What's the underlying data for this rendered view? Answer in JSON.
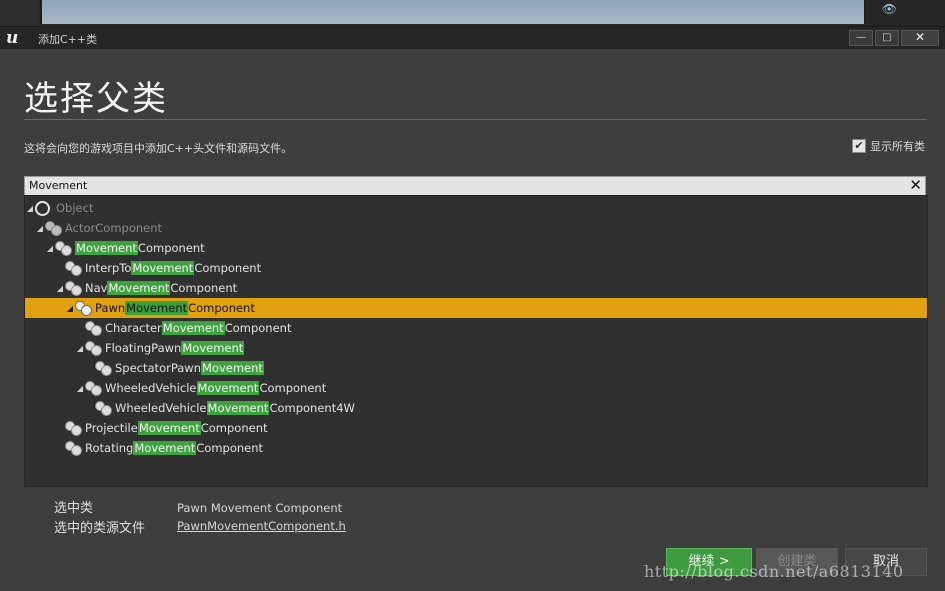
{
  "dialog": {
    "title": "添加C++类",
    "heading": "选择父类",
    "description": "这将会向您的游戏项目中添加C++头文件和源码文件。",
    "show_all_label": "显示所有类",
    "show_all_checked": true
  },
  "window_buttons": {
    "minimize": "—",
    "maximize": "□",
    "close": "✕"
  },
  "search": {
    "value": "Movement",
    "clear": "✕"
  },
  "tree": [
    {
      "pre": "Object",
      "hl": "",
      "post": "",
      "depth": 0,
      "expanded": true,
      "icon": "ring-icon",
      "dim": true,
      "selected": false
    },
    {
      "pre": "ActorComponent",
      "hl": "",
      "post": "",
      "depth": 1,
      "expanded": true,
      "icon": "gears-icon",
      "dim": true,
      "selected": false
    },
    {
      "pre": "",
      "hl": "Movement",
      "post": "Component",
      "depth": 2,
      "expanded": true,
      "icon": "gears-icon",
      "dim": false,
      "selected": false
    },
    {
      "pre": "InterpTo",
      "hl": "Movement",
      "post": "Component",
      "depth": 3,
      "expanded": false,
      "icon": "gears-icon",
      "dim": false,
      "selected": false
    },
    {
      "pre": "Nav",
      "hl": "Movement",
      "post": "Component",
      "depth": 3,
      "expanded": true,
      "icon": "gears-icon",
      "dim": false,
      "selected": false
    },
    {
      "pre": "Pawn",
      "hl": "Movement",
      "post": "Component",
      "depth": 4,
      "expanded": true,
      "icon": "gears-icon",
      "dim": false,
      "selected": true
    },
    {
      "pre": "Character",
      "hl": "Movement",
      "post": "Component",
      "depth": 5,
      "expanded": false,
      "icon": "gears-icon",
      "dim": false,
      "selected": false
    },
    {
      "pre": "FloatingPawn",
      "hl": "Movement",
      "post": "",
      "depth": 5,
      "expanded": true,
      "icon": "gears-icon",
      "dim": false,
      "selected": false
    },
    {
      "pre": "SpectatorPawn",
      "hl": "Movement",
      "post": "",
      "depth": 6,
      "expanded": false,
      "icon": "gears-icon",
      "dim": false,
      "selected": false
    },
    {
      "pre": "WheeledVehicle",
      "hl": "Movement",
      "post": "Component",
      "depth": 5,
      "expanded": true,
      "icon": "gears-icon",
      "dim": false,
      "selected": false
    },
    {
      "pre": "WheeledVehicle",
      "hl": "Movement",
      "post": "Component4W",
      "depth": 6,
      "expanded": false,
      "icon": "gears-icon",
      "dim": false,
      "selected": false
    },
    {
      "pre": "Projectile",
      "hl": "Movement",
      "post": "Component",
      "depth": 3,
      "expanded": false,
      "icon": "gears-icon",
      "dim": false,
      "selected": false
    },
    {
      "pre": "Rotating",
      "hl": "Movement",
      "post": "Component",
      "depth": 3,
      "expanded": false,
      "icon": "gears-icon",
      "dim": false,
      "selected": false
    }
  ],
  "selection": {
    "class_label": "选中类",
    "class_value": "Pawn Movement Component",
    "source_label": "选中的类源文件",
    "source_value": "PawnMovementComponent.h"
  },
  "buttons": {
    "continue": "继续 >",
    "create": "创建类",
    "cancel": "取消"
  },
  "watermark": "http://blog.csdn.net/a6813140",
  "colors": {
    "selected_row": "#e0a010",
    "match_highlight": "#3ea33e",
    "continue_button": "#3f9b3f"
  }
}
